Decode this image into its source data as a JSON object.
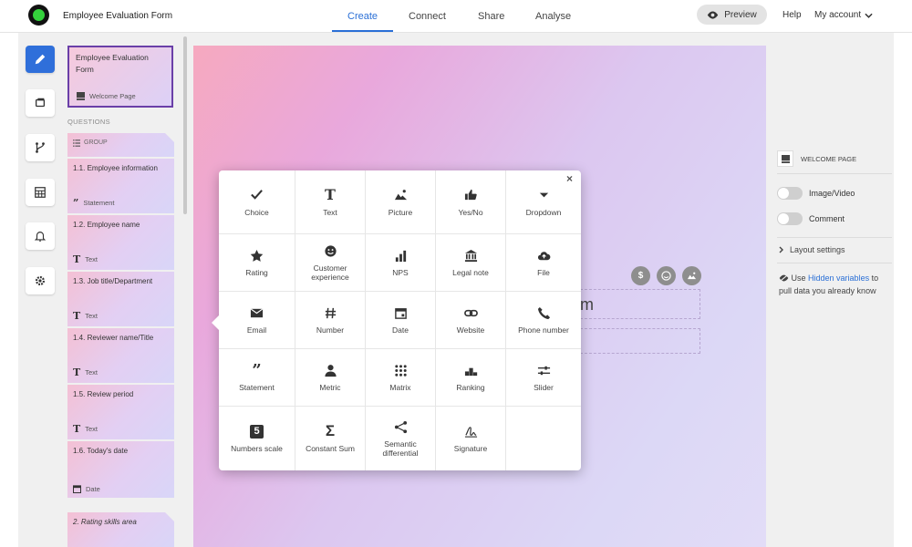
{
  "header": {
    "app_title": "Employee Evaluation Form",
    "tabs": [
      {
        "label": "Create",
        "active": true
      },
      {
        "label": "Connect",
        "active": false
      },
      {
        "label": "Share",
        "active": false
      },
      {
        "label": "Analyse",
        "active": false
      }
    ],
    "preview_label": "Preview",
    "help_label": "Help",
    "account_label": "My account"
  },
  "rail": {
    "items": [
      {
        "icon": "pencil-icon",
        "active": true
      },
      {
        "icon": "themes-icon",
        "active": false
      },
      {
        "icon": "logic-branch-icon",
        "active": false
      },
      {
        "icon": "calculator-icon",
        "active": false
      },
      {
        "icon": "bell-icon",
        "active": false
      },
      {
        "icon": "gear-icon",
        "active": false
      }
    ]
  },
  "question_list": {
    "welcome": {
      "title": "Employee Evaluation Form",
      "subtitle": "Welcome Page"
    },
    "section_label": "QUESTIONS",
    "group_label": "GROUP",
    "questions": [
      {
        "title": "1.1. Employee information",
        "type": "Statement"
      },
      {
        "title": "1.2. Employee name",
        "type": "Text"
      },
      {
        "title": "1.3. Job title/Department",
        "type": "Text"
      },
      {
        "title": "1.4. Reviewer name/Title",
        "type": "Text"
      },
      {
        "title": "1.5. Review period",
        "type": "Text"
      },
      {
        "title": "1.6. Today's date",
        "type": "Date"
      }
    ],
    "next_group": "2. Rating skills area"
  },
  "canvas": {
    "field_text_fragment": "m"
  },
  "type_picker": {
    "close_label": "×",
    "types": [
      {
        "label": "Choice",
        "icon": "check-icon"
      },
      {
        "label": "Text",
        "icon": "text-icon"
      },
      {
        "label": "Picture",
        "icon": "picture-icon"
      },
      {
        "label": "Yes/No",
        "icon": "thumbs-up-icon"
      },
      {
        "label": "Dropdown",
        "icon": "caret-down-icon"
      },
      {
        "label": "Rating",
        "icon": "star-icon"
      },
      {
        "label": "Customer experience",
        "icon": "smiley-icon"
      },
      {
        "label": "NPS",
        "icon": "bar-chart-icon"
      },
      {
        "label": "Legal note",
        "icon": "bank-icon"
      },
      {
        "label": "File",
        "icon": "cloud-upload-icon"
      },
      {
        "label": "Email",
        "icon": "envelope-icon"
      },
      {
        "label": "Number",
        "icon": "hash-icon"
      },
      {
        "label": "Date",
        "icon": "calendar-icon"
      },
      {
        "label": "Website",
        "icon": "link-icon"
      },
      {
        "label": "Phone number",
        "icon": "phone-icon"
      },
      {
        "label": "Statement",
        "icon": "quote-icon"
      },
      {
        "label": "Metric",
        "icon": "person-icon"
      },
      {
        "label": "Matrix",
        "icon": "dot-grid-icon"
      },
      {
        "label": "Ranking",
        "icon": "podium-icon"
      },
      {
        "label": "Slider",
        "icon": "slider-icon"
      },
      {
        "label": "Numbers scale",
        "icon": "number-five-icon",
        "glyph": "5"
      },
      {
        "label": "Constant Sum",
        "icon": "sigma-icon",
        "glyph": "Σ"
      },
      {
        "label": "Semantic differential",
        "icon": "share-nodes-icon"
      },
      {
        "label": "Signature",
        "icon": "signature-icon"
      }
    ]
  },
  "right_panel": {
    "header_label": "WELCOME PAGE",
    "toggles": [
      {
        "label": "Image/Video",
        "on": false
      },
      {
        "label": "Comment",
        "on": false
      }
    ],
    "layout_settings_label": "Layout settings",
    "hidden_prefix": "Use ",
    "hidden_link": "Hidden variables",
    "hidden_suffix": " to pull data you already know"
  }
}
